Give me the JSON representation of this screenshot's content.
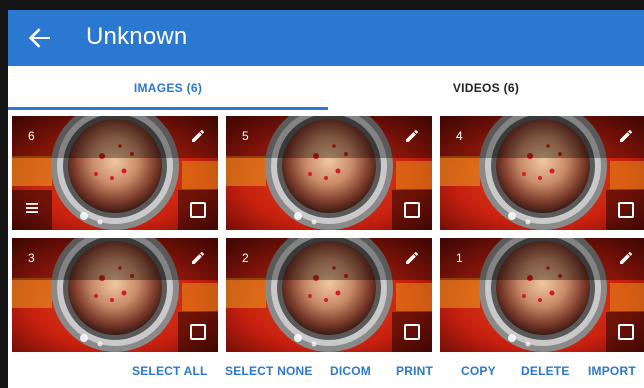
{
  "header": {
    "back_icon": "arrow-left-icon",
    "title": "Unknown"
  },
  "tabs": [
    {
      "label": "IMAGES (6)",
      "active": true
    },
    {
      "label": "VIDEOS (6)",
      "active": false
    }
  ],
  "images": [
    {
      "number": "6",
      "edit_icon": "pencil-icon",
      "checkbox_icon": "checkbox-outline-icon",
      "checked": false,
      "menu_icon": "hamburger-menu-icon"
    },
    {
      "number": "5",
      "edit_icon": "pencil-icon",
      "checkbox_icon": "checkbox-outline-icon",
      "checked": false
    },
    {
      "number": "4",
      "edit_icon": "pencil-icon",
      "checkbox_icon": "checkbox-outline-icon",
      "checked": false
    },
    {
      "number": "3",
      "edit_icon": "pencil-icon",
      "checkbox_icon": "checkbox-outline-icon",
      "checked": false
    },
    {
      "number": "2",
      "edit_icon": "pencil-icon",
      "checkbox_icon": "checkbox-outline-icon",
      "checked": false
    },
    {
      "number": "1",
      "edit_icon": "pencil-icon",
      "checkbox_icon": "checkbox-outline-icon",
      "checked": false
    }
  ],
  "actions": {
    "select_all": "SELECT ALL",
    "select_none": "SELECT NONE",
    "dicom": "DICOM",
    "print": "PRINT",
    "copy": "COPY",
    "delete": "DELETE",
    "import": "IMPORT"
  },
  "colors": {
    "primary": "#2a78cf",
    "appbar_text": "#ffffff",
    "tab_inactive_text": "#222222"
  }
}
